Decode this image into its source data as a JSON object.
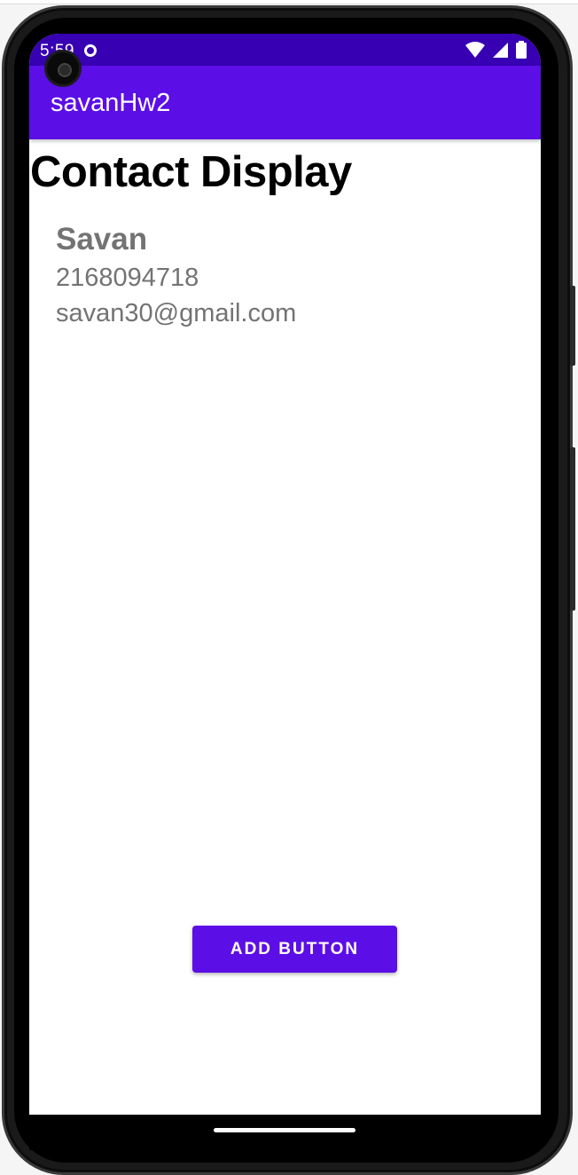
{
  "status_bar": {
    "time": "5:59",
    "icons": [
      "notification-icon",
      "wifi-icon",
      "signal-icon",
      "battery-icon"
    ]
  },
  "app_bar": {
    "title": "savanHw2"
  },
  "main": {
    "heading": "Contact Display",
    "contact": {
      "name": "Savan",
      "phone": "2168094718",
      "email": "savan30@gmail.com"
    },
    "add_button_label": "ADD BUTTON"
  },
  "colors": {
    "primary": "#5c0ee6",
    "primary_dark": "#3700b3",
    "secondary_text": "#737373"
  }
}
